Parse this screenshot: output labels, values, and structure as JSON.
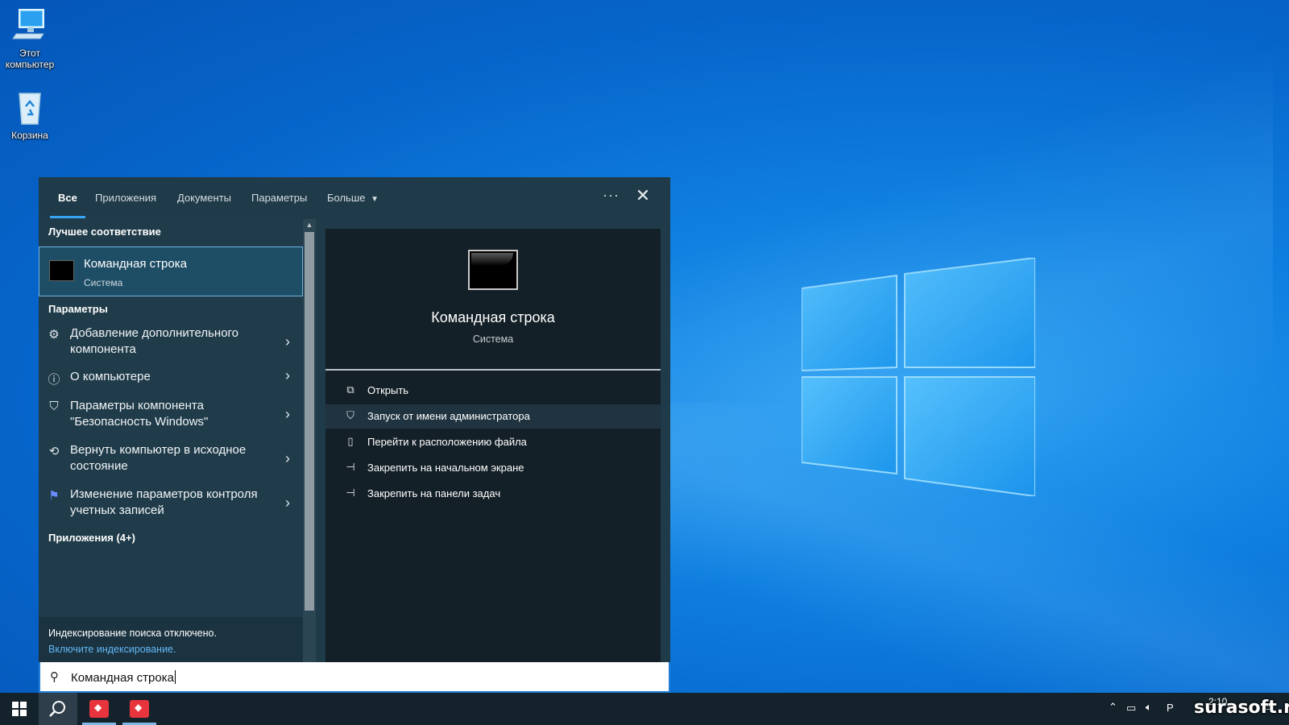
{
  "desktop": {
    "icons": [
      {
        "label_line1": "Этот",
        "label_line2": "компьютер",
        "icon": "computer-icon"
      },
      {
        "label_line1": "Корзина",
        "label_line2": "",
        "icon": "recycle-bin-icon"
      }
    ]
  },
  "search": {
    "tabs": [
      "Все",
      "Приложения",
      "Документы",
      "Параметры",
      "Больше"
    ],
    "active_tab": "Все",
    "more_label": "···",
    "close_label": "✕",
    "best_match_header": "Лучшее соответствие",
    "best_match": {
      "title": "Командная строка",
      "subtitle": "Система"
    },
    "settings_header": "Параметры",
    "settings_items": [
      {
        "label": "Добавление дополнительного компонента",
        "icon": "gear-icon"
      },
      {
        "label": "О компьютере",
        "icon": "info-icon"
      },
      {
        "label": "Параметры компонента \"Безопасность Windows\"",
        "icon": "shield-icon"
      },
      {
        "label": "Вернуть компьютер в исходное состояние",
        "icon": "reset-pc-icon"
      },
      {
        "label": "Изменение параметров контроля учетных записей",
        "icon": "flag-icon"
      }
    ],
    "apps_header": "Приложения (4+)",
    "indexing": {
      "line1": "Индексирование поиска отключено.",
      "link": "Включите индексирование."
    },
    "preview": {
      "title": "Командная строка",
      "subtitle": "Система"
    },
    "actions": [
      {
        "label": "Открыть",
        "icon": "open-icon"
      },
      {
        "label": "Запуск от имени администратора",
        "icon": "admin-shield-icon"
      },
      {
        "label": "Перейти к расположению файла",
        "icon": "file-location-icon"
      },
      {
        "label": "Закрепить на начальном экране",
        "icon": "pin-icon"
      },
      {
        "label": "Закрепить на панели задач",
        "icon": "pin-icon"
      }
    ],
    "query": "Командная строка"
  },
  "taskbar": {
    "clock_time": "2:10",
    "lang": "Р",
    "watermark": "surasoft.ru"
  },
  "colors": {
    "accent": "#3aa4f4",
    "panel": "#1f3a48",
    "preview": "#142028",
    "taskbar": "#14222c"
  }
}
